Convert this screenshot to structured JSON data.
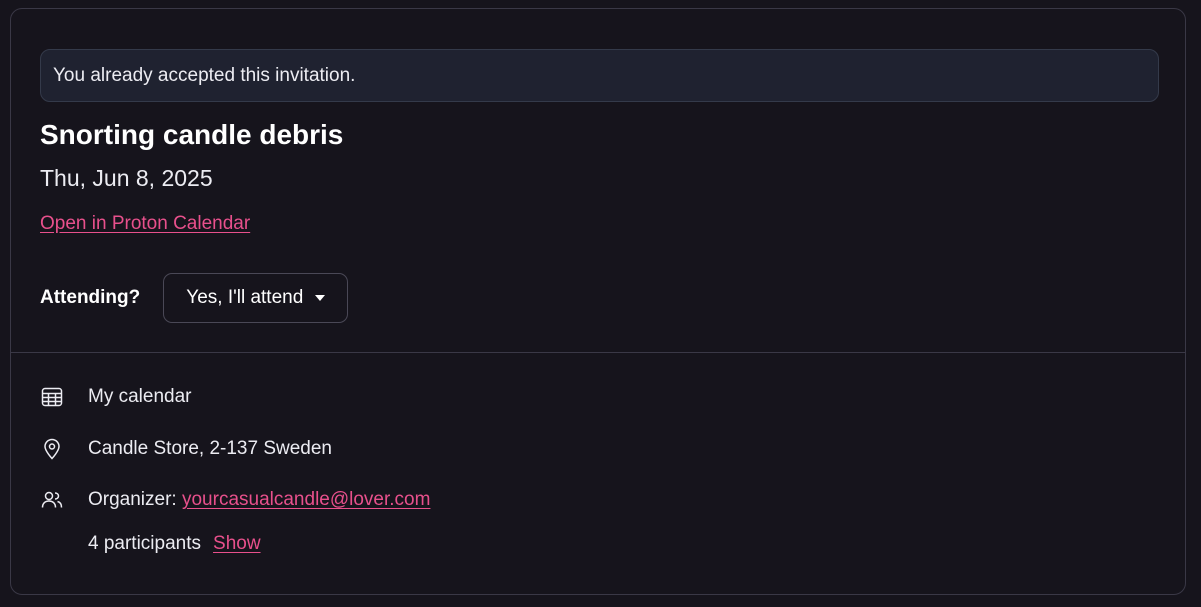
{
  "notice": {
    "text": "You already accepted this invitation."
  },
  "event": {
    "title": "Snorting candle debris",
    "date": "Thu, Jun 8, 2025",
    "open_link": "Open in Proton Calendar"
  },
  "attendance": {
    "label": "Attending?",
    "selected": "Yes, I'll attend"
  },
  "details": {
    "calendar": "My calendar",
    "location": "Candle Store, 2-137 Sweden",
    "organizer_label": "Organizer:",
    "organizer_email": "yourcasualcandle@lover.com",
    "participants_text": "4 participants",
    "show_label": "Show"
  },
  "icons": {
    "calendar": "calendar-grid-icon",
    "location": "map-pin-icon",
    "organizer": "users-icon",
    "dropdown": "caret-down-icon"
  },
  "colors": {
    "background": "#16141c",
    "accent": "#e8508c",
    "notice_bg": "#1f2230",
    "border": "#3a3846"
  }
}
